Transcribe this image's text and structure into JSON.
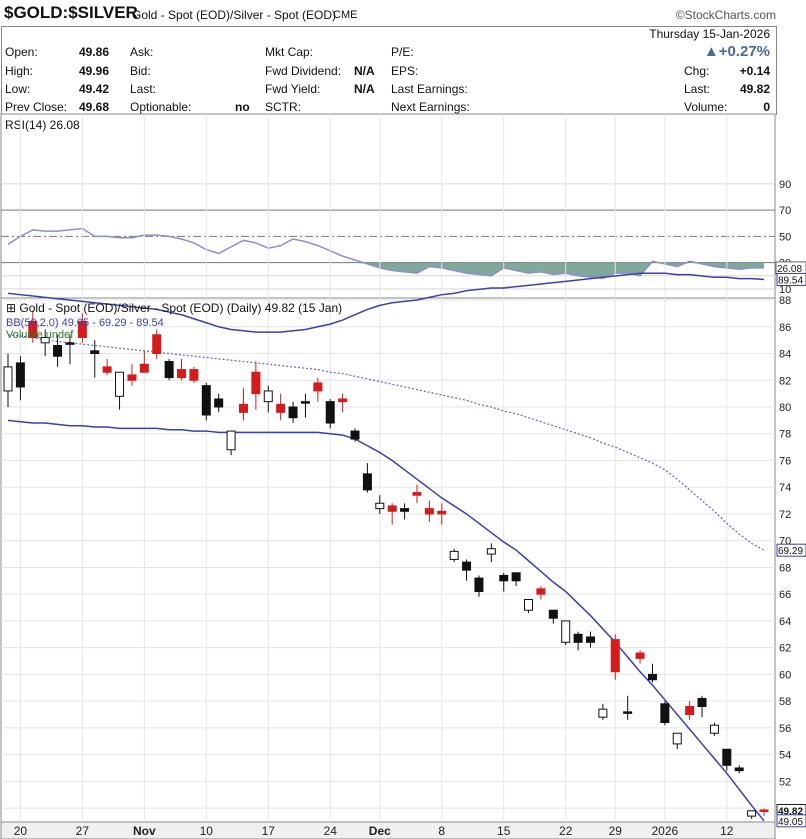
{
  "header": {
    "symbol": "$GOLD:$SILVER",
    "description": "Gold - Spot (EOD)/Silver - Spot (EOD)",
    "exchange": "CME",
    "brand": "©StockCharts.com",
    "date": "Thursday 15-Jan-2026",
    "change_pct": "+0.27%"
  },
  "info": {
    "open_label": "Open:",
    "open": "49.86",
    "high_label": "High:",
    "high": "49.96",
    "low_label": "Low:",
    "low": "49.42",
    "prev_close_label": "Prev Close:",
    "prev_close": "49.68",
    "ask_label": "Ask:",
    "bid_label": "Bid:",
    "last_label_mid": "Last:",
    "optionable_label": "Optionable:",
    "optionable": "no",
    "mktcap_label": "Mkt Cap:",
    "fwd_div_label": "Fwd Dividend:",
    "fwd_div": "N/A",
    "fwd_yield_label": "Fwd Yield:",
    "fwd_yield": "N/A",
    "sctr_label": "SCTR:",
    "pe_label": "P/E:",
    "eps_label": "EPS:",
    "last_earn_label": "Last Earnings:",
    "next_earn_label": "Next Earnings:",
    "chg_label": "Chg:",
    "chg": "+0.14",
    "last_label": "Last:",
    "last": "49.82",
    "volume_label": "Volume:",
    "volume": "0"
  },
  "chart_data": [
    {
      "type": "line",
      "title": "RSI(14) 26.08",
      "ylim": [
        0,
        100
      ],
      "yticks": [
        10,
        20,
        30,
        50,
        70,
        90
      ],
      "ytick_labels": [
        "10",
        "30",
        "50",
        "70",
        "90"
      ],
      "levels": [
        30,
        50,
        70
      ],
      "last_label": "26.08",
      "line_color": "#8a8fd0",
      "fill_color": "#6a9a8a",
      "x": [
        "2025-10-17",
        "2025-10-20",
        "2025-10-21",
        "2025-10-22",
        "2025-10-23",
        "2025-10-24",
        "2025-10-27",
        "2025-10-28",
        "2025-10-29",
        "2025-10-30",
        "2025-10-31",
        "2025-11-03",
        "2025-11-04",
        "2025-11-05",
        "2025-11-06",
        "2025-11-07",
        "2025-11-10",
        "2025-11-11",
        "2025-11-12",
        "2025-11-13",
        "2025-11-14",
        "2025-11-17",
        "2025-11-18",
        "2025-11-19",
        "2025-11-20",
        "2025-11-21",
        "2025-11-24",
        "2025-11-25",
        "2025-11-26",
        "2025-11-28",
        "2025-12-01",
        "2025-12-02",
        "2025-12-03",
        "2025-12-04",
        "2025-12-05",
        "2025-12-08",
        "2025-12-09",
        "2025-12-10",
        "2025-12-11",
        "2025-12-12",
        "2025-12-15",
        "2025-12-16",
        "2025-12-17",
        "2025-12-18",
        "2025-12-19",
        "2025-12-22",
        "2025-12-23",
        "2025-12-24",
        "2025-12-26",
        "2025-12-29",
        "2025-12-30",
        "2025-12-31",
        "2026-01-02",
        "2026-01-05",
        "2026-01-06",
        "2026-01-07",
        "2026-01-08",
        "2026-01-09",
        "2026-01-12",
        "2026-01-13",
        "2026-01-14",
        "2026-01-15"
      ],
      "values": [
        44,
        50,
        55,
        54,
        54,
        55,
        56,
        50,
        50,
        49,
        49,
        51,
        51,
        50,
        48,
        45,
        40,
        37,
        42,
        47,
        45,
        41,
        43,
        48,
        46,
        43,
        39,
        35,
        32,
        29,
        26,
        24,
        23,
        22,
        27,
        26,
        24,
        22,
        21,
        20,
        26,
        24,
        22,
        23,
        21,
        22,
        20,
        19,
        18,
        22,
        22,
        20,
        31,
        29,
        27,
        31,
        29,
        27,
        26,
        25,
        26,
        26
      ]
    },
    {
      "type": "candlestick",
      "title": "Gold - Spot (EOD)/Silver - Spot (EOD) (Daily) 49.82 (15 Jan)",
      "bb_label": "BB(50,2.0) 49.05 - 69.29 - 89.54",
      "volume_label": "Volume undef",
      "ylim": [
        48,
        90
      ],
      "yticks": [
        50,
        52,
        54,
        56,
        58,
        60,
        62,
        64,
        66,
        68,
        70,
        72,
        74,
        76,
        78,
        80,
        82,
        84,
        86,
        88
      ],
      "ytick_labels": [
        "52",
        "54",
        "56",
        "58",
        "60",
        "62",
        "64",
        "66",
        "68",
        "70",
        "72",
        "74",
        "76",
        "78",
        "80",
        "82",
        "84",
        "86",
        "88"
      ],
      "x_tick_labels": [
        "20",
        "27",
        "Nov",
        "10",
        "17",
        "24",
        "Dec",
        "8",
        "15",
        "22",
        "29",
        "2026",
        "12"
      ],
      "price_labels": [
        "89.54",
        "69.29",
        "49.82",
        "49.05"
      ],
      "up_color": "#d41c1c",
      "down_color": "#111111",
      "bb_color": "#3b3fb5",
      "candles": [
        {
          "d": "2025-10-17",
          "o": 81.2,
          "h": 84.0,
          "l": 80.0,
          "c": 83.0
        },
        {
          "d": "2025-10-20",
          "o": 81.5,
          "h": 83.8,
          "l": 80.5,
          "c": 83.3
        },
        {
          "d": "2025-10-21",
          "o": 86.4,
          "h": 87.2,
          "l": 84.8,
          "c": 85.2
        },
        {
          "d": "2025-10-22",
          "o": 84.8,
          "h": 85.8,
          "l": 83.8,
          "c": 85.2
        },
        {
          "d": "2025-10-23",
          "o": 83.8,
          "h": 85.4,
          "l": 83.0,
          "c": 84.6
        },
        {
          "d": "2025-10-24",
          "o": 84.8,
          "h": 85.4,
          "l": 83.2,
          "c": 84.8
        },
        {
          "d": "2025-10-27",
          "o": 86.4,
          "h": 87.0,
          "l": 84.8,
          "c": 85.2
        },
        {
          "d": "2025-10-28",
          "o": 84.0,
          "h": 85.0,
          "l": 82.2,
          "c": 84.2
        },
        {
          "d": "2025-10-29",
          "o": 83.0,
          "h": 83.6,
          "l": 82.4,
          "c": 82.6
        },
        {
          "d": "2025-10-30",
          "o": 80.8,
          "h": 82.6,
          "l": 79.8,
          "c": 82.6
        },
        {
          "d": "2025-10-31",
          "o": 82.4,
          "h": 83.2,
          "l": 81.6,
          "c": 82.0
        },
        {
          "d": "2025-11-03",
          "o": 83.2,
          "h": 84.2,
          "l": 82.6,
          "c": 82.6
        },
        {
          "d": "2025-11-04",
          "o": 85.4,
          "h": 85.8,
          "l": 83.6,
          "c": 84.0
        },
        {
          "d": "2025-11-05",
          "o": 82.2,
          "h": 83.6,
          "l": 82.0,
          "c": 83.4
        },
        {
          "d": "2025-11-06",
          "o": 82.8,
          "h": 83.6,
          "l": 82.0,
          "c": 82.2
        },
        {
          "d": "2025-11-07",
          "o": 82.8,
          "h": 83.0,
          "l": 81.8,
          "c": 82.0
        },
        {
          "d": "2025-11-10",
          "o": 79.4,
          "h": 81.8,
          "l": 79.0,
          "c": 81.6
        },
        {
          "d": "2025-11-11",
          "o": 80.0,
          "h": 81.0,
          "l": 79.6,
          "c": 80.6
        },
        {
          "d": "2025-11-12",
          "o": 76.8,
          "h": 78.2,
          "l": 76.4,
          "c": 78.2
        },
        {
          "d": "2025-11-13",
          "o": 80.2,
          "h": 81.4,
          "l": 79.0,
          "c": 79.6
        },
        {
          "d": "2025-11-14",
          "o": 82.6,
          "h": 83.4,
          "l": 79.8,
          "c": 81.0
        },
        {
          "d": "2025-11-17",
          "o": 80.4,
          "h": 81.6,
          "l": 79.6,
          "c": 81.2
        },
        {
          "d": "2025-11-18",
          "o": 80.2,
          "h": 81.0,
          "l": 79.0,
          "c": 79.6
        },
        {
          "d": "2025-11-19",
          "o": 79.2,
          "h": 80.4,
          "l": 78.8,
          "c": 80.0
        },
        {
          "d": "2025-11-20",
          "o": 80.4,
          "h": 81.0,
          "l": 79.2,
          "c": 80.4
        },
        {
          "d": "2025-11-21",
          "o": 81.8,
          "h": 82.2,
          "l": 80.4,
          "c": 81.2
        },
        {
          "d": "2025-11-24",
          "o": 78.8,
          "h": 80.6,
          "l": 78.4,
          "c": 80.4
        },
        {
          "d": "2025-11-25",
          "o": 80.6,
          "h": 81.0,
          "l": 79.6,
          "c": 80.4
        },
        {
          "d": "2025-11-26",
          "o": 77.6,
          "h": 78.4,
          "l": 77.4,
          "c": 78.2
        },
        {
          "d": "2025-11-28",
          "o": 73.8,
          "h": 75.8,
          "l": 73.6,
          "c": 75.0
        },
        {
          "d": "2025-12-01",
          "o": 72.4,
          "h": 73.4,
          "l": 72.0,
          "c": 72.8
        },
        {
          "d": "2025-12-02",
          "o": 72.6,
          "h": 72.8,
          "l": 71.2,
          "c": 72.2
        },
        {
          "d": "2025-12-03",
          "o": 72.2,
          "h": 72.8,
          "l": 71.6,
          "c": 72.4
        },
        {
          "d": "2025-12-04",
          "o": 73.6,
          "h": 74.2,
          "l": 72.8,
          "c": 73.4
        },
        {
          "d": "2025-12-05",
          "o": 72.4,
          "h": 73.0,
          "l": 71.4,
          "c": 72.0
        },
        {
          "d": "2025-12-08",
          "o": 72.2,
          "h": 72.8,
          "l": 71.2,
          "c": 72.0
        },
        {
          "d": "2025-12-09",
          "o": 68.6,
          "h": 69.4,
          "l": 68.4,
          "c": 69.2
        },
        {
          "d": "2025-12-10",
          "o": 67.8,
          "h": 68.6,
          "l": 67.0,
          "c": 68.4
        },
        {
          "d": "2025-12-11",
          "o": 66.2,
          "h": 67.4,
          "l": 65.8,
          "c": 67.2
        },
        {
          "d": "2025-12-12",
          "o": 69.0,
          "h": 69.8,
          "l": 68.4,
          "c": 69.4
        },
        {
          "d": "2025-12-15",
          "o": 67.0,
          "h": 67.6,
          "l": 66.2,
          "c": 67.4
        },
        {
          "d": "2025-12-16",
          "o": 67.0,
          "h": 67.4,
          "l": 66.6,
          "c": 67.6
        },
        {
          "d": "2025-12-17",
          "o": 64.8,
          "h": 65.6,
          "l": 64.6,
          "c": 65.6
        },
        {
          "d": "2025-12-18",
          "o": 66.4,
          "h": 66.6,
          "l": 65.6,
          "c": 66.0
        },
        {
          "d": "2025-12-19",
          "o": 64.2,
          "h": 64.8,
          "l": 63.8,
          "c": 64.8
        },
        {
          "d": "2025-12-22",
          "o": 62.4,
          "h": 64.0,
          "l": 62.2,
          "c": 64.0
        },
        {
          "d": "2025-12-23",
          "o": 62.4,
          "h": 63.2,
          "l": 61.8,
          "c": 63.0
        },
        {
          "d": "2025-12-24",
          "o": 62.4,
          "h": 63.2,
          "l": 62.0,
          "c": 62.8
        },
        {
          "d": "2025-12-26",
          "o": 56.8,
          "h": 57.8,
          "l": 56.6,
          "c": 57.4
        },
        {
          "d": "2025-12-29",
          "o": 62.6,
          "h": 63.0,
          "l": 59.6,
          "c": 60.2
        },
        {
          "d": "2025-12-30",
          "o": 57.2,
          "h": 58.4,
          "l": 56.6,
          "c": 57.2
        },
        {
          "d": "2025-12-31",
          "o": 61.6,
          "h": 61.8,
          "l": 60.8,
          "c": 61.2
        },
        {
          "d": "2026-01-02",
          "o": 59.6,
          "h": 60.8,
          "l": 59.4,
          "c": 60.0
        },
        {
          "d": "2026-01-05",
          "o": 56.4,
          "h": 58.0,
          "l": 56.2,
          "c": 57.8
        },
        {
          "d": "2026-01-06",
          "o": 54.8,
          "h": 55.6,
          "l": 54.4,
          "c": 55.6
        },
        {
          "d": "2026-01-07",
          "o": 57.6,
          "h": 58.0,
          "l": 56.6,
          "c": 57.0
        },
        {
          "d": "2026-01-08",
          "o": 57.6,
          "h": 58.4,
          "l": 56.8,
          "c": 58.2
        },
        {
          "d": "2026-01-09",
          "o": 55.6,
          "h": 56.4,
          "l": 55.4,
          "c": 56.2
        },
        {
          "d": "2026-01-12",
          "o": 53.2,
          "h": 54.4,
          "l": 52.8,
          "c": 54.4
        },
        {
          "d": "2026-01-13",
          "o": 52.8,
          "h": 53.2,
          "l": 52.6,
          "c": 53.0
        },
        {
          "d": "2026-01-14",
          "o": 49.4,
          "h": 49.8,
          "l": 49.2,
          "c": 49.8
        },
        {
          "d": "2026-01-15",
          "o": 49.86,
          "h": 49.96,
          "l": 49.42,
          "c": 49.82
        }
      ],
      "bb_upper": [
        88.5,
        88.4,
        88.3,
        88.2,
        88.1,
        88.0,
        87.9,
        87.8,
        87.7,
        87.6,
        87.5,
        87.4,
        87.3,
        87.1,
        86.9,
        86.6,
        86.3,
        86.0,
        85.8,
        85.7,
        85.6,
        85.6,
        85.6,
        85.7,
        85.8,
        86.0,
        86.2,
        86.5,
        86.9,
        87.3,
        87.6,
        87.8,
        87.9,
        88.0,
        88.2,
        88.4,
        88.5,
        88.7,
        88.8,
        88.9,
        88.9,
        89.0,
        89.1,
        89.2,
        89.3,
        89.4,
        89.5,
        89.6,
        89.7,
        89.8,
        89.9,
        90.0,
        90.0,
        90.0,
        89.9,
        89.9,
        89.8,
        89.7,
        89.7,
        89.6,
        89.6,
        89.54
      ],
      "bb_middle": [
        85.4,
        85.3,
        85.2,
        85.0,
        84.9,
        84.8,
        84.7,
        84.6,
        84.5,
        84.4,
        84.3,
        84.2,
        84.1,
        84.0,
        83.9,
        83.8,
        83.7,
        83.6,
        83.5,
        83.4,
        83.3,
        83.2,
        83.1,
        83.0,
        82.9,
        82.8,
        82.6,
        82.5,
        82.3,
        82.1,
        81.9,
        81.7,
        81.5,
        81.3,
        81.1,
        80.9,
        80.7,
        80.5,
        80.2,
        80.0,
        79.7,
        79.5,
        79.2,
        78.9,
        78.6,
        78.3,
        78.0,
        77.7,
        77.3,
        77.0,
        76.6,
        76.2,
        75.8,
        75.3,
        74.6,
        73.8,
        73.0,
        72.2,
        71.3,
        70.5,
        69.8,
        69.29
      ],
      "bb_lower": [
        79.0,
        78.9,
        78.8,
        78.8,
        78.7,
        78.6,
        78.6,
        78.5,
        78.5,
        78.4,
        78.4,
        78.4,
        78.4,
        78.3,
        78.3,
        78.2,
        78.2,
        78.1,
        78.1,
        78.1,
        78.1,
        78.1,
        78.1,
        78.1,
        78.1,
        78.1,
        78.0,
        77.9,
        77.6,
        77.1,
        76.6,
        76.0,
        75.3,
        74.6,
        73.9,
        73.2,
        72.6,
        72.0,
        71.3,
        70.6,
        69.9,
        69.3,
        68.5,
        67.7,
        66.9,
        66.2,
        65.3,
        64.4,
        63.4,
        62.4,
        61.3,
        60.2,
        59.2,
        58.1,
        57.0,
        55.9,
        54.8,
        53.7,
        52.6,
        51.4,
        50.2,
        49.05
      ]
    }
  ]
}
